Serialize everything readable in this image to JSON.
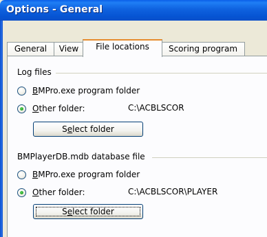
{
  "window": {
    "title": "Options - General"
  },
  "tabs": [
    {
      "label": "General",
      "active": false
    },
    {
      "label": "View",
      "active": false
    },
    {
      "label": "File locations",
      "active": true
    },
    {
      "label": "Scoring program",
      "active": false
    }
  ],
  "log_files": {
    "group_label": "Log files",
    "option_program": {
      "accel": "B",
      "rest": "MPro.exe program folder",
      "selected": false
    },
    "option_other": {
      "accel": "O",
      "rest": "ther folder:",
      "selected": true
    },
    "path": "C:\\ACBLSCOR",
    "select_button": {
      "pre": "S",
      "accel": "e",
      "rest": "lect folder"
    }
  },
  "db_file": {
    "group_label": "BMPlayerDB.mdb database file",
    "option_program": {
      "accel": "B",
      "rest": "MPro.exe program folder",
      "selected": false
    },
    "option_other": {
      "accel": "O",
      "rest": "ther folder:",
      "selected": true
    },
    "path": "C:\\ACBLSCOR\\PLAYER",
    "select_button": {
      "pre": "S",
      "accel": "e",
      "rest": "lect folder"
    }
  }
}
